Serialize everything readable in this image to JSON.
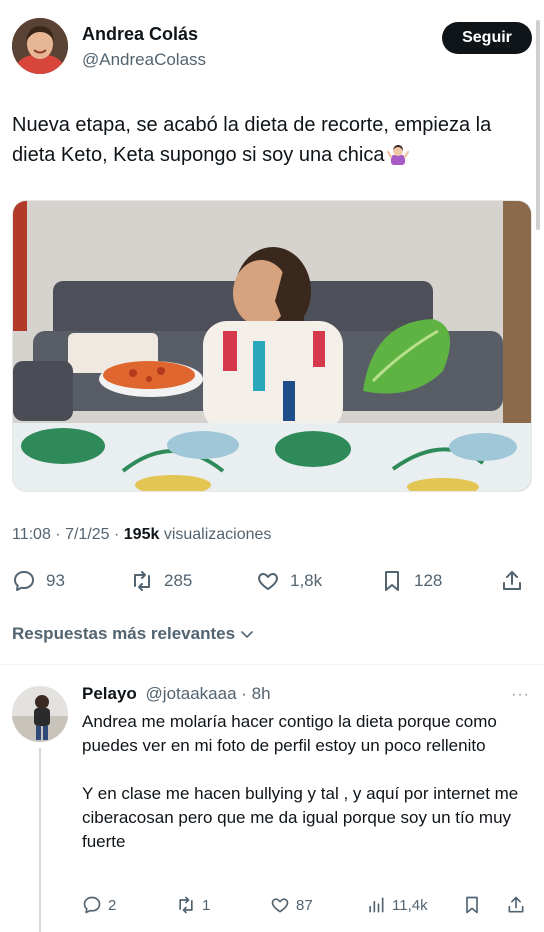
{
  "tweet": {
    "author": {
      "name": "Andrea Colás",
      "handle": "@AndreaColass"
    },
    "follow_label": "Seguir",
    "text": "Nueva etapa, se acabó la dieta de recorte, empieza la dieta Keto, Keta supongo si soy una chica",
    "emoji_icon": "woman-shrugging-icon",
    "time": "11:08 · 7/1/25 · ",
    "views_count": "195k",
    "views_label": " visualizaciones",
    "stats": {
      "replies": "93",
      "retweets": "285",
      "likes": "1,8k",
      "bookmarks": "128"
    }
  },
  "replies_sort_label": "Respuestas más relevantes",
  "reply": {
    "name": "Pelayo",
    "handle": "@jotaakaaa · 8h",
    "more": "···",
    "text": "Andrea me molaría hacer contigo la dieta porque como puedes ver en mi foto de perfil estoy un poco rellenito\n\nY en clase me hacen bullying y tal , y aquí por internet me ciberacosan pero que me da igual porque soy un tío muy fuerte",
    "stats": {
      "replies": "2",
      "retweets": "1",
      "likes": "87",
      "views": "11,4k"
    }
  },
  "colors": {
    "text": "#0f1419",
    "muted": "#536471",
    "follow_bg": "#0f1419"
  }
}
